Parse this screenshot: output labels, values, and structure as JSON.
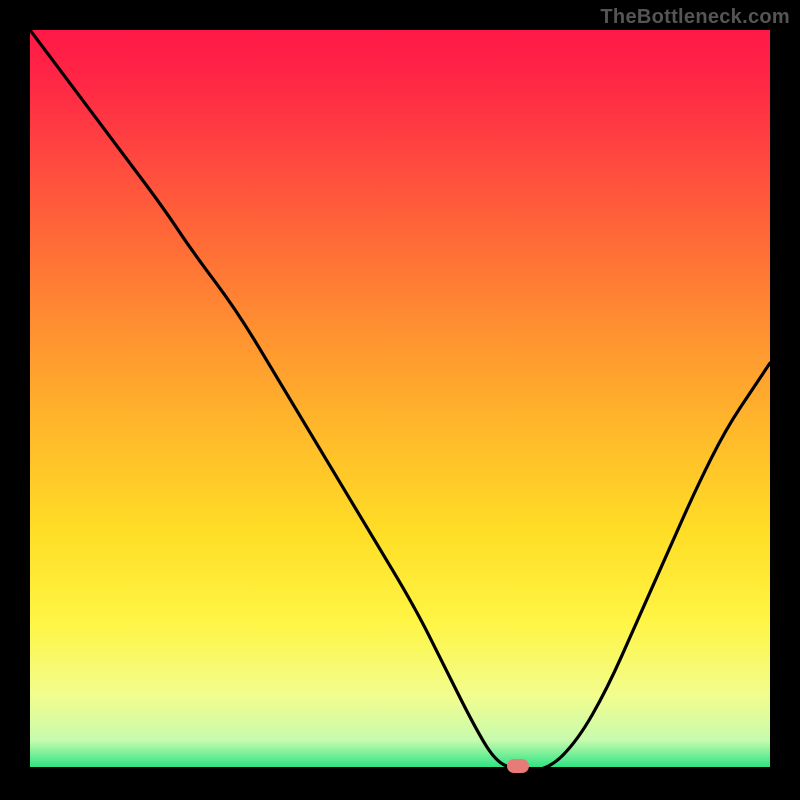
{
  "watermark": "TheBottleneck.com",
  "chart_data": {
    "type": "line",
    "title": "",
    "xlabel": "",
    "ylabel": "",
    "xlim": [
      0,
      100
    ],
    "ylim": [
      0,
      100
    ],
    "grid": false,
    "legend": false,
    "background_gradient_stops": [
      {
        "offset": 0.0,
        "color": "#ff1846"
      },
      {
        "offset": 0.08,
        "color": "#ff2a45"
      },
      {
        "offset": 0.18,
        "color": "#ff4a3f"
      },
      {
        "offset": 0.3,
        "color": "#ff6f36"
      },
      {
        "offset": 0.42,
        "color": "#ff9530"
      },
      {
        "offset": 0.55,
        "color": "#ffbb2a"
      },
      {
        "offset": 0.68,
        "color": "#ffde26"
      },
      {
        "offset": 0.8,
        "color": "#fff545"
      },
      {
        "offset": 0.9,
        "color": "#f2fd8e"
      },
      {
        "offset": 0.96,
        "color": "#c6fbae"
      },
      {
        "offset": 1.0,
        "color": "#1ee27e"
      }
    ],
    "series": [
      {
        "name": "bottleneck-curve",
        "color": "#000000",
        "x": [
          0,
          6,
          12,
          18,
          22,
          28,
          34,
          40,
          46,
          52,
          56,
          60,
          63,
          66,
          70,
          74,
          78,
          82,
          86,
          90,
          94,
          98,
          100
        ],
        "values": [
          100,
          92,
          84,
          76,
          70,
          62,
          52,
          42,
          32,
          22,
          14,
          6,
          1,
          0,
          0,
          4,
          11,
          20,
          29,
          38,
          46,
          52,
          55
        ]
      }
    ],
    "marker": {
      "name": "optimal-point",
      "x": 66,
      "y": 0.5,
      "color": "#e77b77"
    }
  }
}
